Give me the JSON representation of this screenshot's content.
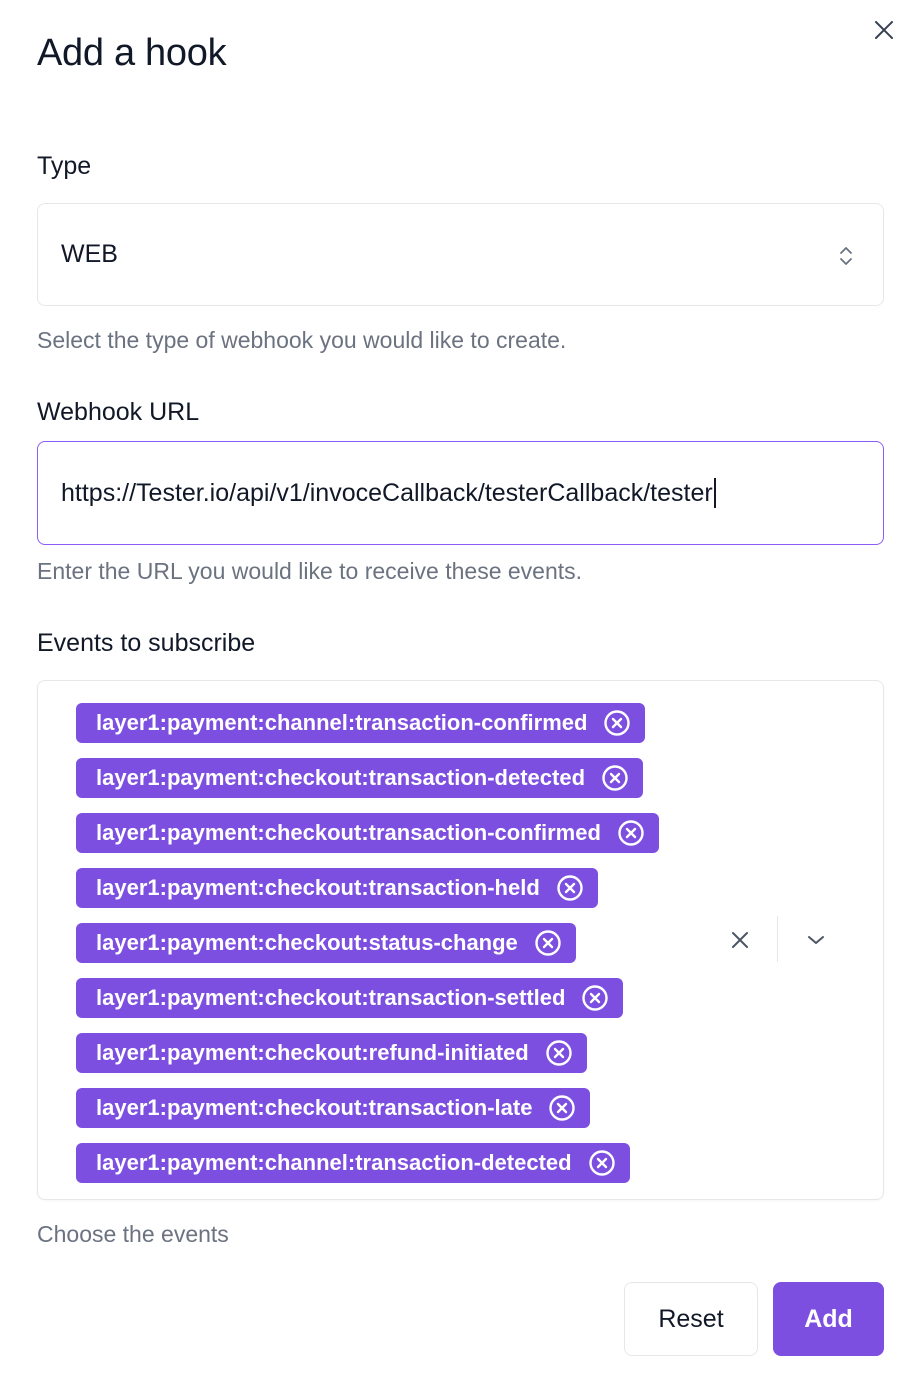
{
  "modal": {
    "title": "Add a hook"
  },
  "type_field": {
    "label": "Type",
    "value": "WEB",
    "help": "Select the type of webhook you would like to create."
  },
  "url_field": {
    "label": "Webhook URL",
    "value": "https://Tester.io/api/v1/invoceCallback/testerCallback/tester",
    "help": "Enter the URL you would like to receive these events."
  },
  "events_field": {
    "label": "Events to subscribe",
    "help": "Choose the events",
    "selected": [
      "layer1:payment:channel:transaction-confirmed",
      "layer1:payment:checkout:transaction-detected",
      "layer1:payment:checkout:transaction-confirmed",
      "layer1:payment:checkout:transaction-held",
      "layer1:payment:checkout:status-change",
      "layer1:payment:checkout:transaction-settled",
      "layer1:payment:checkout:refund-initiated",
      "layer1:payment:checkout:transaction-late",
      "layer1:payment:channel:transaction-detected"
    ]
  },
  "actions": {
    "reset_label": "Reset",
    "add_label": "Add"
  },
  "colors": {
    "accent": "#7c4fe0",
    "focus_border": "#8b5cf6",
    "help_text": "#6b7280"
  }
}
